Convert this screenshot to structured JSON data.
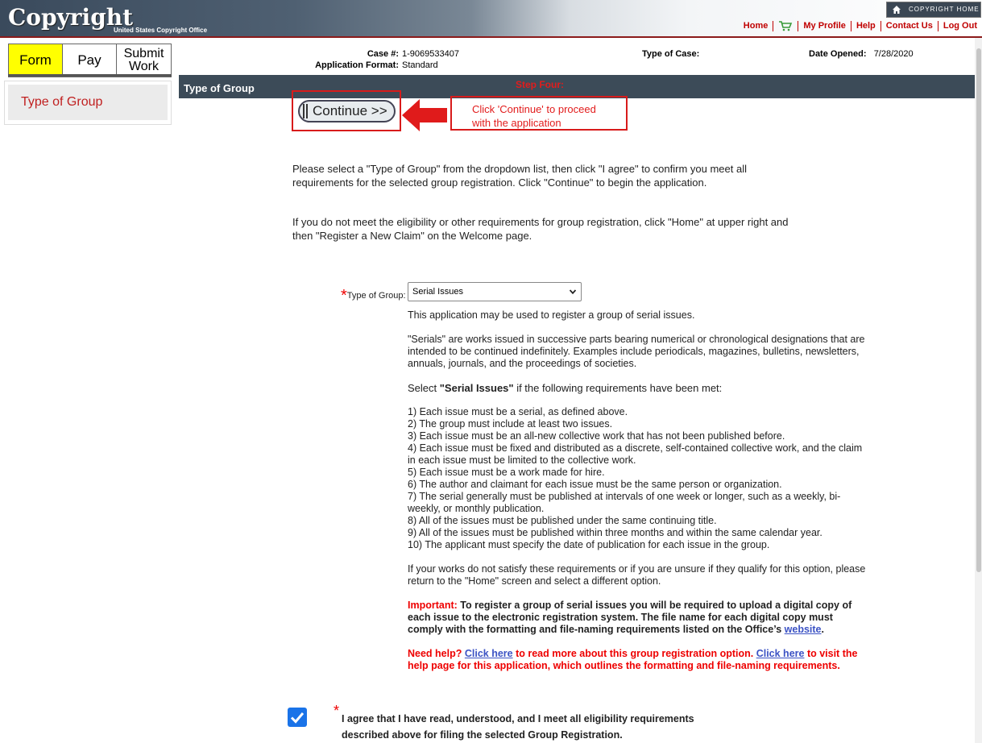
{
  "header": {
    "logo_text": "Copyright",
    "logo_sub": "United States Copyright Office",
    "home_badge": "COPYRIGHT HOME",
    "nav": [
      "Home",
      "My Profile",
      "Help",
      "Contact Us",
      "Log Out"
    ]
  },
  "tabs": {
    "form": "Form",
    "pay": "Pay",
    "submit": "Submit Work"
  },
  "sidebar": {
    "item": "Type of Group"
  },
  "case": {
    "case_label": "Case #:",
    "case_value": "1-9069533407",
    "format_label": "Application Format:",
    "format_value": "Standard",
    "type_label": "Type of Case:",
    "date_label": "Date Opened:",
    "date_value": "7/28/2020"
  },
  "section": {
    "title": "Type of Group",
    "step": "Step Four:"
  },
  "continue": {
    "label": "Continue >>"
  },
  "callout": {
    "line1": "Click 'Continue' to proceed",
    "line2": "with the application"
  },
  "intro": {
    "p1": "Please select a \"Type of Group\" from the dropdown list, then click \"I agree\" to confirm you meet all requirements for the selected group registration. Click \"Continue\" to begin the application.",
    "p2": "If you do not meet the eligibility or other requirements for group registration, click \"Home\" at upper right and then \"Register a New Claim\" on the Welcome page."
  },
  "type_of_group": {
    "asterisk": "*",
    "label": "Type of Group:",
    "selected": "Serial Issues"
  },
  "description": {
    "p1": "This application may be used to register a group of serial issues.",
    "p2": "\"Serials\" are works issued in successive parts bearing numerical or chronological designations that are intended to be continued indefinitely. Examples include periodicals, magazines, bulletins, newsletters, annuals, journals, and the proceedings of societies.",
    "select_pre": "Select ",
    "select_bold": "\"Serial Issues\"",
    "select_post": " if the following requirements have been met:",
    "requirements": [
      "1) Each issue must be a serial, as defined above.",
      "2) The group must include at least two issues.",
      "3) Each issue must be an all-new collective work that has not been published before.",
      "4) Each issue must be fixed and distributed as a discrete, self-contained collective work, and the claim in each issue must be limited to the collective work.",
      "5) Each issue must be a work made for hire.",
      "6) The author and claimant for each issue must be the same person or organization.",
      "7) The serial generally must be published at intervals of one week or longer, such as a weekly, bi-weekly, or monthly publication.",
      "8) All of the issues must be published under the same continuing title.",
      "9) All of the issues must be published within three months and within the same calendar year.",
      "10) The applicant must specify the date of publication for each issue in the group."
    ],
    "p4": "If your works do not satisfy these requirements or if you are unsure if they qualify for this option, please return to the \"Home\" screen and select a different option.",
    "important_label": "Important:",
    "important_text": " To register a group of serial issues you will be required to upload a digital copy of each issue to the electronic registration system. The file name for each digital copy must comply with the formatting and file-naming requirements listed on the Office’s ",
    "website_link": "website",
    "important_end": ".",
    "help_1": "Need help? ",
    "help_link1": "Click here",
    "help_2": " to read more about this group registration option. ",
    "help_link2": "Click here",
    "help_3": " to visit the help page for this application, which outlines the formatting and file-naming requirements."
  },
  "agree": {
    "asterisk": "*",
    "text": "I agree that I have read, understood, and I meet all eligibility requirements described above for filing the selected Group Registration.",
    "checked": true
  },
  "colors": {
    "header": "#3c4b58",
    "accent_red": "#c00000",
    "tab_active": "#ffff00",
    "checkbox": "#1a73e8"
  }
}
